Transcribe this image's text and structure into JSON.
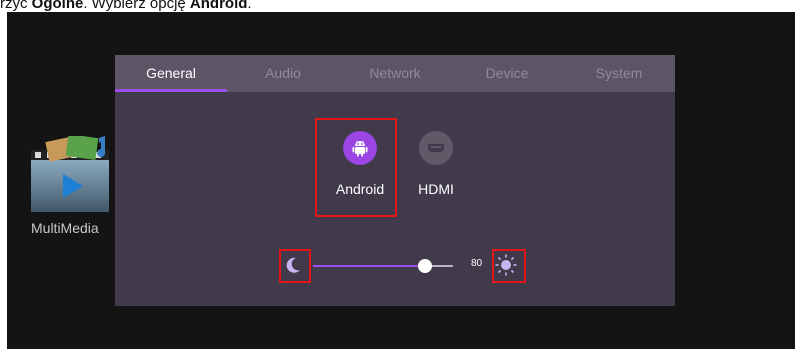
{
  "caption": {
    "prefix": "rzyć",
    "bold1": "Ogólne",
    "middle": ". Wybierz opcję ",
    "bold2": "Android",
    "suffix": "."
  },
  "desktop": {
    "icon_label": "MultiMedia"
  },
  "tabs": [
    {
      "label": "General",
      "active": true
    },
    {
      "label": "Audio",
      "active": false
    },
    {
      "label": "Network",
      "active": false
    },
    {
      "label": "Device",
      "active": false
    },
    {
      "label": "System",
      "active": false
    }
  ],
  "sources": [
    {
      "label": "Android",
      "icon": "android-icon",
      "selected": true
    },
    {
      "label": "HDMI",
      "icon": "hdmi-icon",
      "selected": false
    }
  ],
  "brightness": {
    "value": 80,
    "value_label": "80",
    "min_icon": "moon-icon",
    "max_icon": "sun-icon"
  },
  "colors": {
    "accent": "#9c4ee8",
    "highlight": "#e0161b",
    "panel": "#403a4a",
    "tabbar": "#5b5566"
  }
}
